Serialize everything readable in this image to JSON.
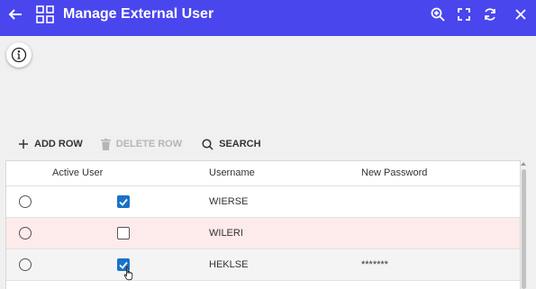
{
  "app": {
    "title": "Manage External User",
    "bar_color": "#4a46ee",
    "icons": [
      "back-arrow-icon",
      "app-grid-icon",
      "zoom-in-icon",
      "fullscreen-icon",
      "refresh-icon",
      "close-icon",
      "info-icon"
    ]
  },
  "toolbar": {
    "add_row": "ADD ROW",
    "delete_row": "DELETE ROW",
    "search": "SEARCH"
  },
  "table": {
    "columns": [
      "Active User",
      "Username",
      "New Password"
    ],
    "rows": [
      {
        "active": true,
        "username": "WIERSE",
        "password": "",
        "state": "normal"
      },
      {
        "active": false,
        "username": "WILERI",
        "password": "",
        "state": "error"
      },
      {
        "active": true,
        "username": "HEKLSE",
        "password": "*******",
        "state": "hover"
      }
    ]
  }
}
